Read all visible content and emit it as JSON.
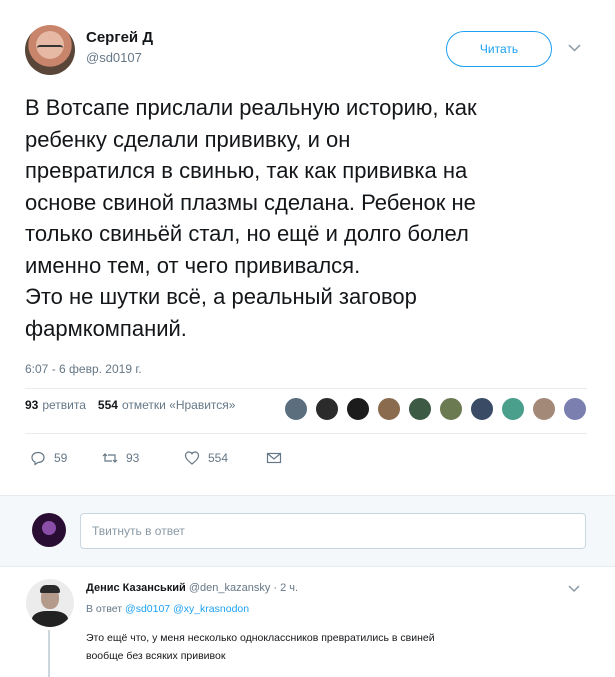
{
  "tweet": {
    "author_name": "Сергей Д",
    "author_handle": "@sd0107",
    "follow_label": "Читать",
    "text_lines": [
      "В Вотсапе прислали реальную историю, как",
      "ребенку сделали прививку, и он",
      "превратился в свинью, так как прививка на",
      "основе свиной плазмы сделана. Ребенок не",
      "только свиньёй стал, но ещё и долго болел",
      "именно тем, от чего прививался.",
      "Это не шутки всё, а реальный заговор",
      "фармкомпаний."
    ],
    "timestamp": "6:07 - 6 февр. 2019 г."
  },
  "stats": {
    "retweets_count": "93",
    "retweets_label": "ретвита",
    "likes_count": "554",
    "likes_label": "отметки «Нравится»"
  },
  "likers": {
    "colors": [
      "#5a6e7d",
      "#2b2b2b",
      "#1c1c1c",
      "#8a6b4e",
      "#3d5a45",
      "#6c7a52",
      "#3a4b66",
      "#4a9e8c",
      "#a38978",
      "#7b7fb0"
    ]
  },
  "actions": {
    "reply_count": "59",
    "retweet_count": "93",
    "like_count": "554"
  },
  "reply_composer": {
    "placeholder": "Твитнуть в ответ"
  },
  "reply": {
    "author_name": "Денис Казанський",
    "author_handle": "@den_kazansky",
    "time": "· 2 ч.",
    "reply_prefix": "В ответ",
    "reply_mention_1": "@sd0107",
    "reply_mention_2": "@xy_krasnodon",
    "text_line_1": "Это ещё что, у меня несколько одноклассников превратились в свиней",
    "text_line_2": "вообще без всяких прививок"
  },
  "colors": {
    "accent": "#1da1f2",
    "secondary_text": "#657786",
    "divider": "#e6ecf0",
    "background_light": "#f5f8fa"
  },
  "icons": {
    "reply": "reply-icon",
    "retweet": "retweet-icon",
    "like": "heart-icon",
    "message": "envelope-icon",
    "menu": "chevron-down-icon"
  }
}
